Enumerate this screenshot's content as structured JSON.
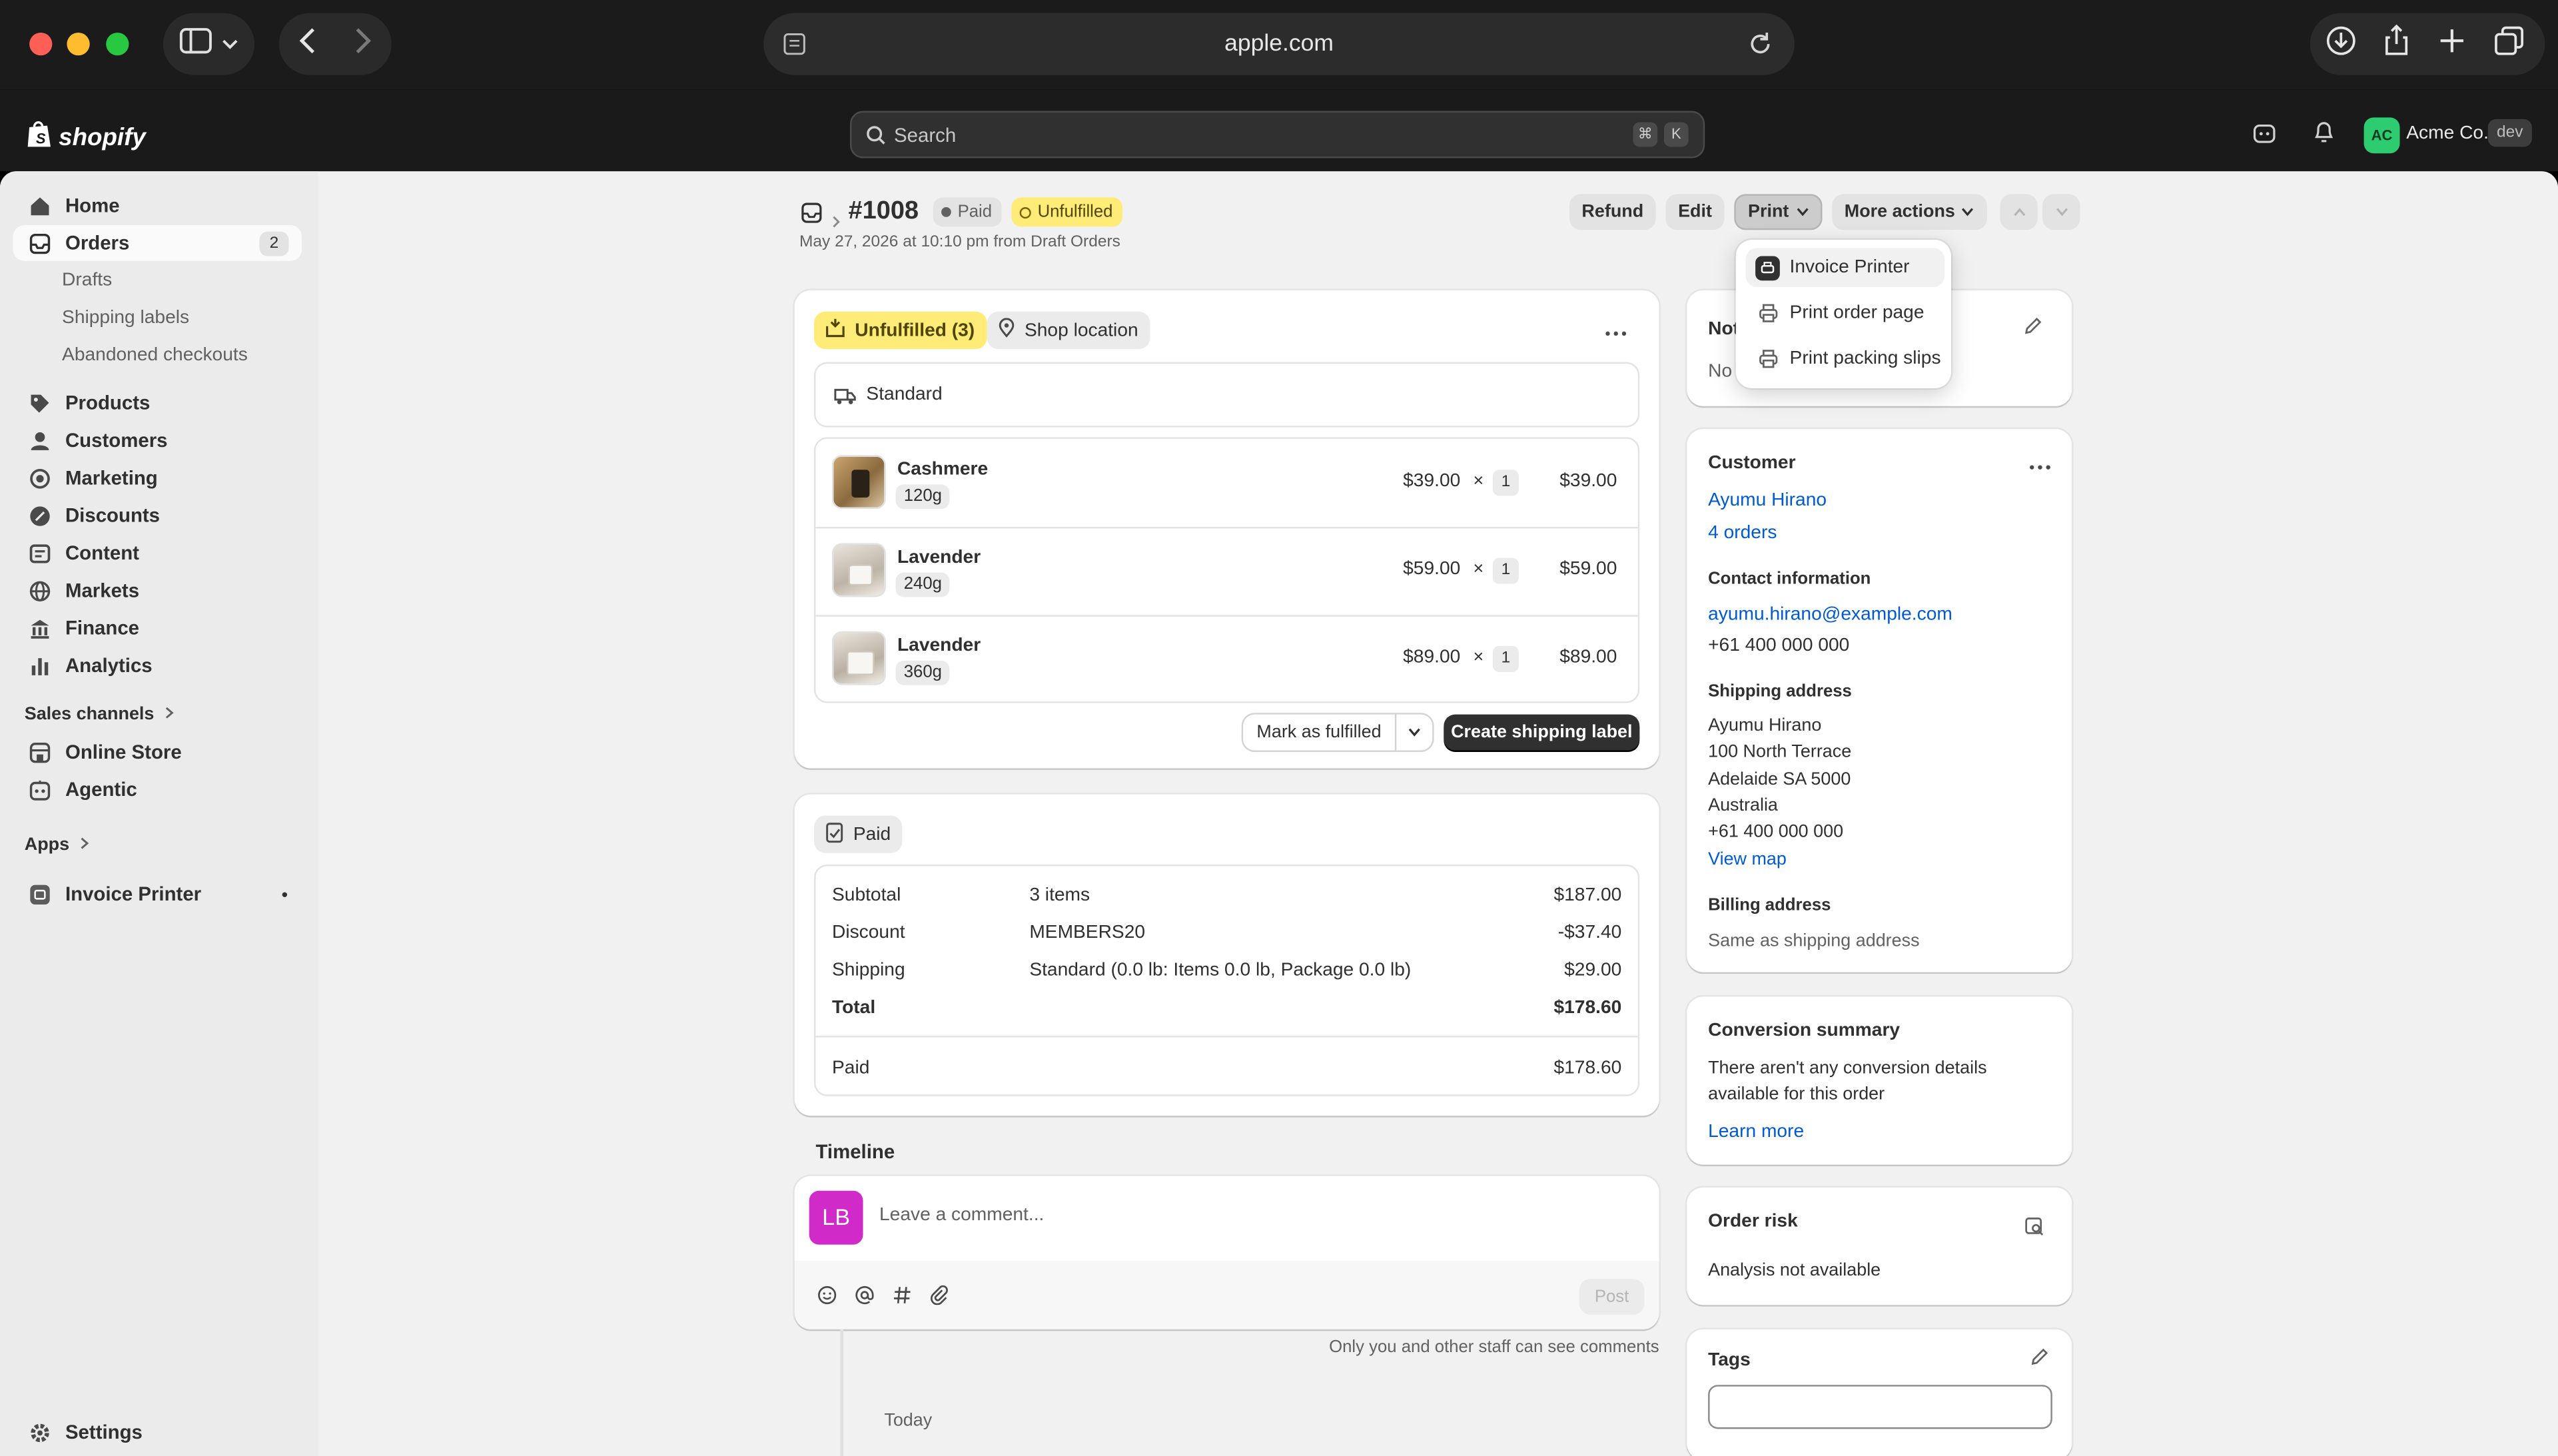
{
  "browser": {
    "url": "apple.com",
    "colors": {
      "close": "#ff5f57",
      "minimize": "#febc2e",
      "zoom": "#28c840"
    }
  },
  "topbar": {
    "logo_text": "shopify",
    "search_placeholder": "Search",
    "shortcut_keys": [
      "⌘",
      "K"
    ],
    "store_initials": "AC",
    "store_name": "Acme Co.",
    "store_badge": "dev"
  },
  "sidebar": {
    "items": [
      {
        "label": "Home",
        "icon": "home-icon"
      },
      {
        "label": "Orders",
        "icon": "inbox-icon",
        "count": "2",
        "selected": true
      },
      {
        "label": "Products",
        "icon": "tag-icon"
      },
      {
        "label": "Customers",
        "icon": "person-icon"
      },
      {
        "label": "Marketing",
        "icon": "target-icon"
      },
      {
        "label": "Discounts",
        "icon": "discount-icon"
      },
      {
        "label": "Content",
        "icon": "content-icon"
      },
      {
        "label": "Markets",
        "icon": "globe-icon"
      },
      {
        "label": "Finance",
        "icon": "bank-icon"
      },
      {
        "label": "Analytics",
        "icon": "bar-chart-icon"
      }
    ],
    "order_subitems": [
      "Drafts",
      "Shipping labels",
      "Abandoned checkouts"
    ],
    "sales_channels_label": "Sales channels",
    "channels": [
      "Online Store",
      "Agentic"
    ],
    "apps_label": "Apps",
    "apps": [
      "Invoice Printer"
    ],
    "settings_label": "Settings"
  },
  "order": {
    "number": "#1008",
    "payment_status": "Paid",
    "fulfillment_status": "Unfulfilled",
    "subtitle": "May 27, 2026 at 10:10 pm from Draft Orders",
    "actions": {
      "refund": "Refund",
      "edit": "Edit",
      "print": "Print",
      "more": "More actions"
    }
  },
  "print_menu": {
    "items": [
      "Invoice Printer",
      "Print order page",
      "Print packing slips"
    ]
  },
  "fulfillment": {
    "status_label": "Unfulfilled (3)",
    "location_label": "Shop location",
    "shipping_method": "Standard",
    "line_items": [
      {
        "name": "Cashmere",
        "variant": "120g",
        "price": "$39.00",
        "times": "×",
        "qty": "1",
        "total": "$39.00"
      },
      {
        "name": "Lavender",
        "variant": "240g",
        "price": "$59.00",
        "times": "×",
        "qty": "1",
        "total": "$59.00"
      },
      {
        "name": "Lavender",
        "variant": "360g",
        "price": "$89.00",
        "times": "×",
        "qty": "1",
        "total": "$89.00"
      }
    ],
    "mark_fulfilled": "Mark as fulfilled",
    "create_label": "Create shipping label"
  },
  "payment": {
    "badge": "Paid",
    "rows": [
      {
        "label": "Subtotal",
        "detail": "3 items",
        "amount": "$187.00"
      },
      {
        "label": "Discount",
        "detail": "MEMBERS20",
        "amount": "-$37.40"
      },
      {
        "label": "Shipping",
        "detail": "Standard (0.0 lb: Items 0.0 lb, Package 0.0 lb)",
        "amount": "$29.00"
      }
    ],
    "total_label": "Total",
    "total_amount": "$178.60",
    "paid_label": "Paid",
    "paid_amount": "$178.60"
  },
  "timeline": {
    "title": "Timeline",
    "avatar_initials": "LB",
    "comment_placeholder": "Leave a comment...",
    "post_label": "Post",
    "note": "Only you and other staff can see comments",
    "today": "Today"
  },
  "notes": {
    "title": "Not",
    "body": "No"
  },
  "customer": {
    "title": "Customer",
    "name": "Ayumu Hirano",
    "orders": "4 orders",
    "contact_title": "Contact information",
    "email": "ayumu.hirano@example.com",
    "phone": "+61 400 000 000",
    "shipping_title": "Shipping address",
    "address": [
      "Ayumu Hirano",
      "100 North Terrace",
      "Adelaide SA 5000",
      "Australia",
      "+61 400 000 000"
    ],
    "view_map": "View map",
    "billing_title": "Billing address",
    "billing": "Same as shipping address"
  },
  "conversion": {
    "title": "Conversion summary",
    "body_line1": "There aren't any conversion details",
    "body_line2": "available for this order",
    "link": "Learn more"
  },
  "risk": {
    "title": "Order risk",
    "body": "Analysis not available"
  },
  "tags": {
    "title": "Tags",
    "value": ""
  }
}
